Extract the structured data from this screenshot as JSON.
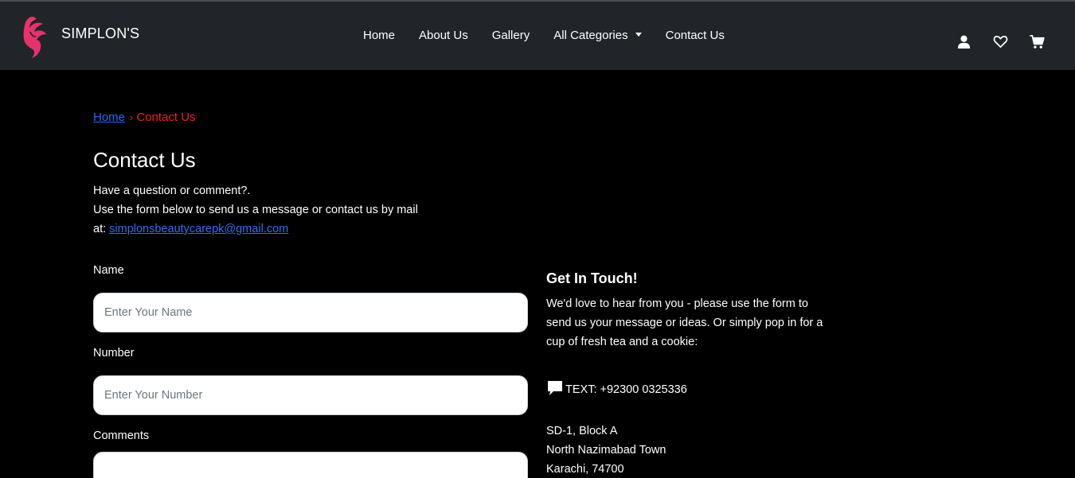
{
  "nav": {
    "brand": "SIMPLON'S",
    "links": [
      "Home",
      "About Us",
      "Gallery",
      "All Categories",
      "Contact Us"
    ],
    "icons": [
      "user-icon",
      "heart-icon",
      "cart-icon"
    ]
  },
  "breadcrumb": {
    "home": "Home",
    "separator": "›",
    "current": "Contact Us"
  },
  "page": {
    "title": "Contact Us",
    "line1": "Have a question or comment?.",
    "line2": "Use the form below to send us a message or contact us by mail",
    "line3_prefix": "at:",
    "email": "simplonsbeautycarepk@gmail.com"
  },
  "form": {
    "name_label": "Name",
    "name_placeholder": "Enter Your Name",
    "number_label": "Number",
    "number_placeholder": "Enter Your Number",
    "comments_label": "Comments"
  },
  "touch": {
    "title": "Get In Touch!",
    "text": "We'd love to hear from you - please use the form to send us your message or ideas. Or simply pop in for a cup of fresh tea and a cookie:",
    "phone": "TEXT: +92300 0325336",
    "address": [
      "SD-1, Block A",
      "North Nazimabad Town",
      "Karachi, 74700"
    ]
  },
  "colors": {
    "brand_pink": "#e8326e",
    "nav_bg": "#212529",
    "link_blue": "#1f6df0",
    "breadcrumb_red": "#ee2020"
  }
}
